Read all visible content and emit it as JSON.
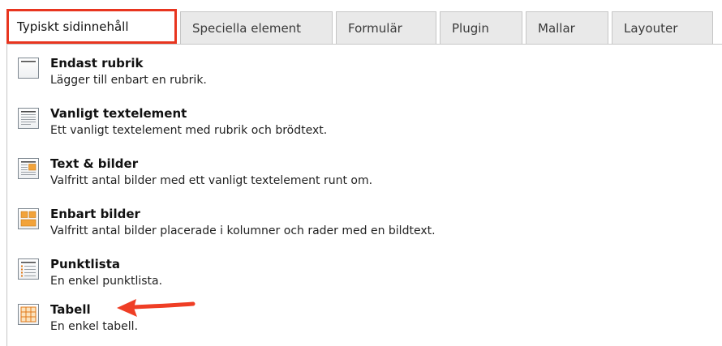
{
  "tabs": [
    {
      "label": "Typiskt sidinnehåll",
      "active": true
    },
    {
      "label": "Speciella element",
      "active": false
    },
    {
      "label": "Formulär",
      "active": false
    },
    {
      "label": "Plugin",
      "active": false
    },
    {
      "label": "Mallar",
      "active": false
    },
    {
      "label": "Layouter",
      "active": false
    }
  ],
  "items": [
    {
      "title": "Endast rubrik",
      "description": "Lägger till enbart en rubrik.",
      "icon": "header-only-icon"
    },
    {
      "title": "Vanligt textelement",
      "description": "Ett vanligt textelement med rubrik och brödtext.",
      "icon": "text-element-icon"
    },
    {
      "title": "Text & bilder",
      "description": "Valfritt antal bilder med ett vanligt textelement runt om.",
      "icon": "text-image-icon"
    },
    {
      "title": "Enbart bilder",
      "description": "Valfritt antal bilder placerade i kolumner och rader med en bildtext.",
      "icon": "images-only-icon"
    },
    {
      "title": "Punktlista",
      "description": "En enkel punktlista.",
      "icon": "bullet-list-icon"
    },
    {
      "title": "Tabell",
      "description": "En enkel tabell.",
      "icon": "table-icon"
    }
  ],
  "colors": {
    "highlight": "#e8351f",
    "icon_accent": "#f2a33a"
  }
}
